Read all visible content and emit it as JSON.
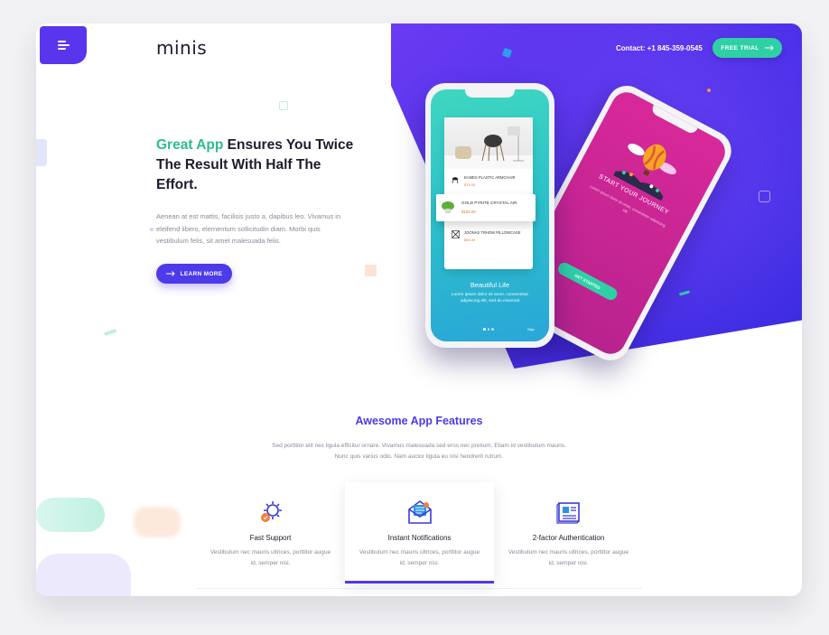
{
  "header": {
    "logo": "minis",
    "contact": "Contact: +1 845-359-0545",
    "trial_button": "FREE TRIAL"
  },
  "hero": {
    "headline_accent": "Great App",
    "headline_rest": " Ensures You Twice The Result With Half The Effort.",
    "text": "Aenean at est mattis, facilisis justo a, dapibus leo. Vivamus in eleifend libero, elementum sollicitudin diam. Morbi quis vestibulum felis, sit amet malesuada felis.",
    "button": "LEARN MORE"
  },
  "phone_left": {
    "products": [
      {
        "name": "EAMES PLASTIC ARMCHAIR",
        "price": "$79.00"
      },
      {
        "name": "GOLD PYRITE CRYSTAL AIR",
        "price": "$100.00"
      },
      {
        "name": "JOONAS TRHOW PILLOWCASE",
        "price": "$55.00"
      }
    ],
    "title": "Beautiful Life",
    "subtitle": "Lorem ipsum dolor sit amet, consectetur adipiscing elit, sed do eiusmod",
    "skip": "Skip"
  },
  "phone_right": {
    "title": "START YOUR JOURNEY",
    "subtitle": "Lorem ipsum dolor sit amet, consectetur adipiscing elit",
    "button": "GET STARTED"
  },
  "features": {
    "title": "Awesome App Features",
    "description": "Sed porttitor elit nec ligula efficitur ornare. Vivamus malesuada sed eros nec pretium. Etiam id vestibulum mauris. Nunc quis varius odio. Nam auctor ligula eu nisi hendrerit rutrum.",
    "items": [
      {
        "name": "Fast Support",
        "text": "Vestibulum nec mauris ultrices, porttitor augue id, semper nisi.",
        "icon": "gear-icon"
      },
      {
        "name": "Instant Notifications",
        "text": "Vestibulum nec mauris ultrices, porttitor augue id, semper nisi.",
        "icon": "envelope-icon"
      },
      {
        "name": "2-factor Authentication",
        "text": "Vestibulum nec mauris ultrices, porttitor augue id, semper nisi.",
        "icon": "document-icon"
      }
    ]
  },
  "colors": {
    "primary": "#4d3ae8",
    "accent": "#2cbc93",
    "pink": "#d8289a"
  }
}
